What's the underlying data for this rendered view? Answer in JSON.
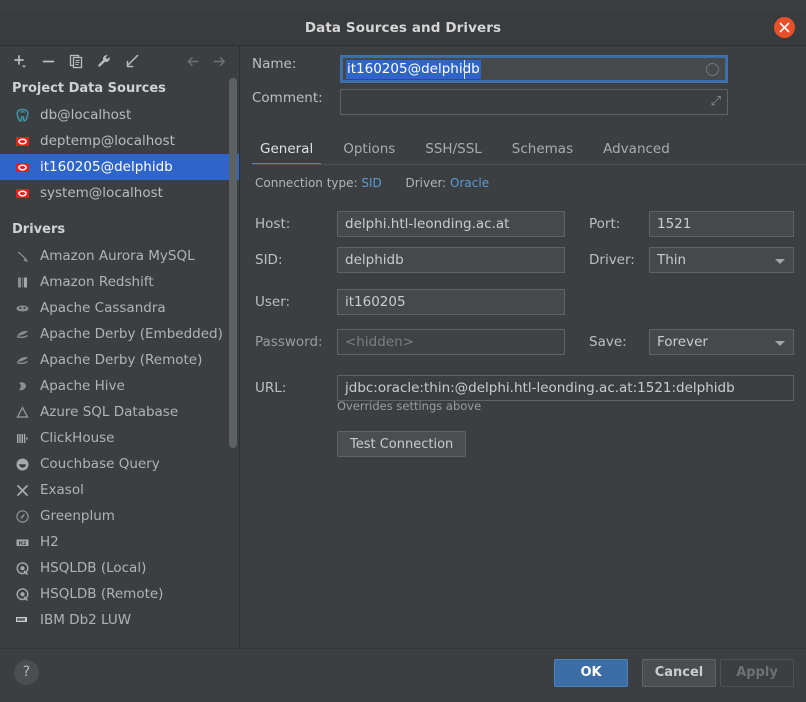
{
  "window": {
    "title": "Data Sources and Drivers",
    "close_icon": "close-icon"
  },
  "toolbar": {
    "buttons": [
      {
        "name": "add-button",
        "icon": "plus-icon"
      },
      {
        "name": "remove-button",
        "icon": "minus-icon"
      },
      {
        "name": "duplicate-button",
        "icon": "copy-icon"
      },
      {
        "name": "properties-button",
        "icon": "wrench-icon"
      },
      {
        "name": "import-button",
        "icon": "arrow-down-left-icon"
      }
    ],
    "nav_back": "arrow-left-icon",
    "nav_forward": "arrow-right-icon"
  },
  "sidebar": {
    "project_header": "Project Data Sources",
    "data_sources": [
      {
        "label": "db@localhost",
        "icon": "postgresql-icon",
        "selected": false
      },
      {
        "label": "deptemp@localhost",
        "icon": "oracle-icon",
        "selected": false
      },
      {
        "label": "it160205@delphidb",
        "icon": "oracle-icon",
        "selected": true
      },
      {
        "label": "system@localhost",
        "icon": "oracle-icon",
        "selected": false
      }
    ],
    "drivers_header": "Drivers",
    "drivers": [
      {
        "label": "Amazon Aurora MySQL",
        "icon": "aurora-icon"
      },
      {
        "label": "Amazon Redshift",
        "icon": "redshift-icon"
      },
      {
        "label": "Apache Cassandra",
        "icon": "cassandra-icon"
      },
      {
        "label": "Apache Derby (Embedded)",
        "icon": "derby-icon"
      },
      {
        "label": "Apache Derby (Remote)",
        "icon": "derby-icon"
      },
      {
        "label": "Apache Hive",
        "icon": "hive-icon"
      },
      {
        "label": "Azure SQL Database",
        "icon": "azure-icon"
      },
      {
        "label": "ClickHouse",
        "icon": "clickhouse-icon"
      },
      {
        "label": "Couchbase Query",
        "icon": "couchbase-icon"
      },
      {
        "label": "Exasol",
        "icon": "exasol-icon"
      },
      {
        "label": "Greenplum",
        "icon": "greenplum-icon"
      },
      {
        "label": "H2",
        "icon": "h2-icon"
      },
      {
        "label": "HSQLDB (Local)",
        "icon": "hsqldb-icon"
      },
      {
        "label": "HSQLDB (Remote)",
        "icon": "hsqldb-icon"
      },
      {
        "label": "IBM Db2 LUW",
        "icon": "db2-icon"
      }
    ]
  },
  "form": {
    "name_label": "Name:",
    "name_value": "it160205@delphidb",
    "comment_label": "Comment:",
    "comment_value": "",
    "tabs": [
      {
        "label": "General",
        "active": true
      },
      {
        "label": "Options",
        "active": false
      },
      {
        "label": "SSH/SSL",
        "active": false
      },
      {
        "label": "Schemas",
        "active": false
      },
      {
        "label": "Advanced",
        "active": false
      }
    ],
    "connection_type_label": "Connection type:",
    "connection_type_value": "SID",
    "driver_link_label": "Driver:",
    "driver_link_value": "Oracle",
    "host_label": "Host:",
    "host_value": "delphi.htl-leonding.ac.at",
    "port_label": "Port:",
    "port_value": "1521",
    "sid_label": "SID:",
    "sid_value": "delphidb",
    "driver_label": "Driver:",
    "driver_value": "Thin",
    "user_label": "User:",
    "user_value": "it160205",
    "password_label": "Password:",
    "password_placeholder": "<hidden>",
    "save_label": "Save:",
    "save_value": "Forever",
    "url_label": "URL:",
    "url_value": "jdbc:oracle:thin:@delphi.htl-leonding.ac.at:1521:delphidb",
    "url_hint": "Overrides settings above",
    "test_connection_label": "Test Connection"
  },
  "footer": {
    "help_label": "?",
    "ok_label": "OK",
    "cancel_label": "Cancel",
    "apply_label": "Apply"
  },
  "colors": {
    "accent_blue": "#2f65ca",
    "link_blue": "#5c9ad6",
    "tab_underline": "#4a88c7",
    "close_red": "#e8502a",
    "oracle_red": "#e2201c",
    "postgres_teal": "#3f93a8",
    "panel_bg": "#3c3f41",
    "ok_blue": "#3c6ea5"
  }
}
